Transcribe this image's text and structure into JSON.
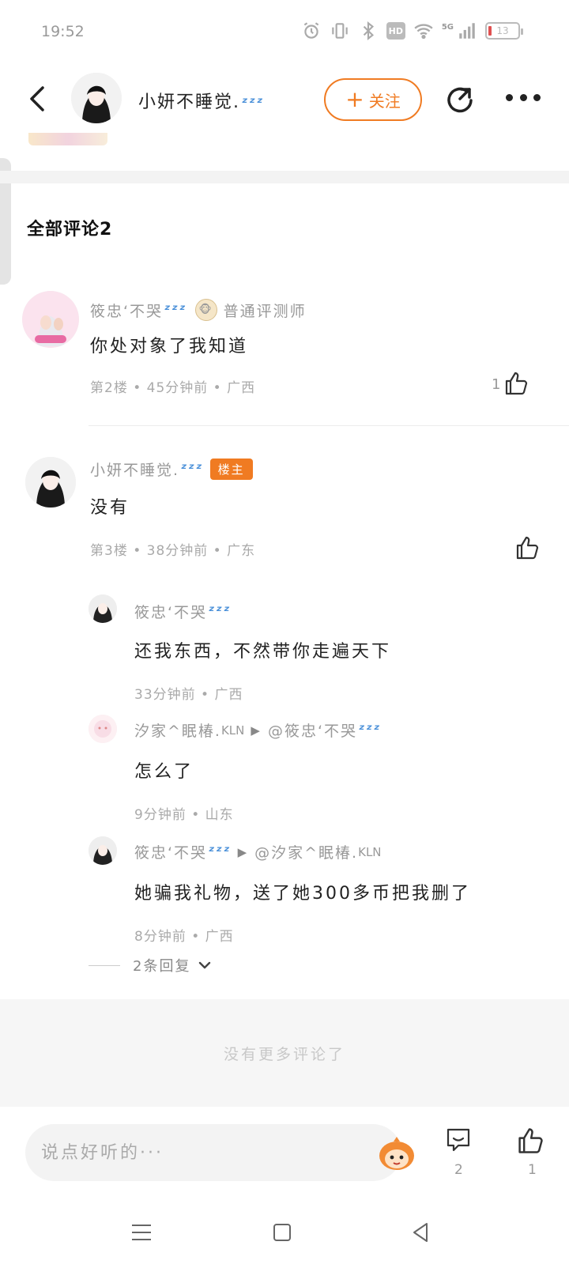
{
  "status_bar": {
    "time": "19:52",
    "network": "5G",
    "hd": "HD",
    "battery": "13"
  },
  "header": {
    "user_name": "小妍不睡觉.",
    "follow_label": "关注"
  },
  "section_title": "全部评论2",
  "comments": [
    {
      "name": "筱忠‘不哭",
      "badge": "普通评测师",
      "text": "你处对象了我知道",
      "meta": "第2楼 • 45分钟前 • 广西",
      "likes": "1"
    },
    {
      "name": "小妍不睡觉.",
      "badge": "楼主",
      "text": "没有",
      "meta": "第3楼 • 38分钟前 • 广东",
      "replies": [
        {
          "name": "筱忠‘不哭",
          "text": "还我东西，不然带你走遍天下",
          "meta": "33分钟前 • 广西"
        },
        {
          "name": "汐家^眠椿.",
          "name_sup": "KLN",
          "reply_to": "@筱忠‘不哭",
          "text": "怎么了",
          "meta": "9分钟前 • 山东"
        },
        {
          "name": "筱忠‘不哭",
          "reply_to": "@汐家^眠椿.",
          "reply_to_sup": "KLN",
          "text": "她骗我礼物，送了她300多币把我删了",
          "meta": "8分钟前 • 广西"
        }
      ],
      "replies_toggle": "2条回复"
    }
  ],
  "no_more": "没有更多评论了",
  "bottom": {
    "placeholder": "说点好听的···",
    "comment_count": "2",
    "like_count": "1"
  },
  "colors": {
    "accent": "#f07b22",
    "zzz": "#4a90d9"
  }
}
